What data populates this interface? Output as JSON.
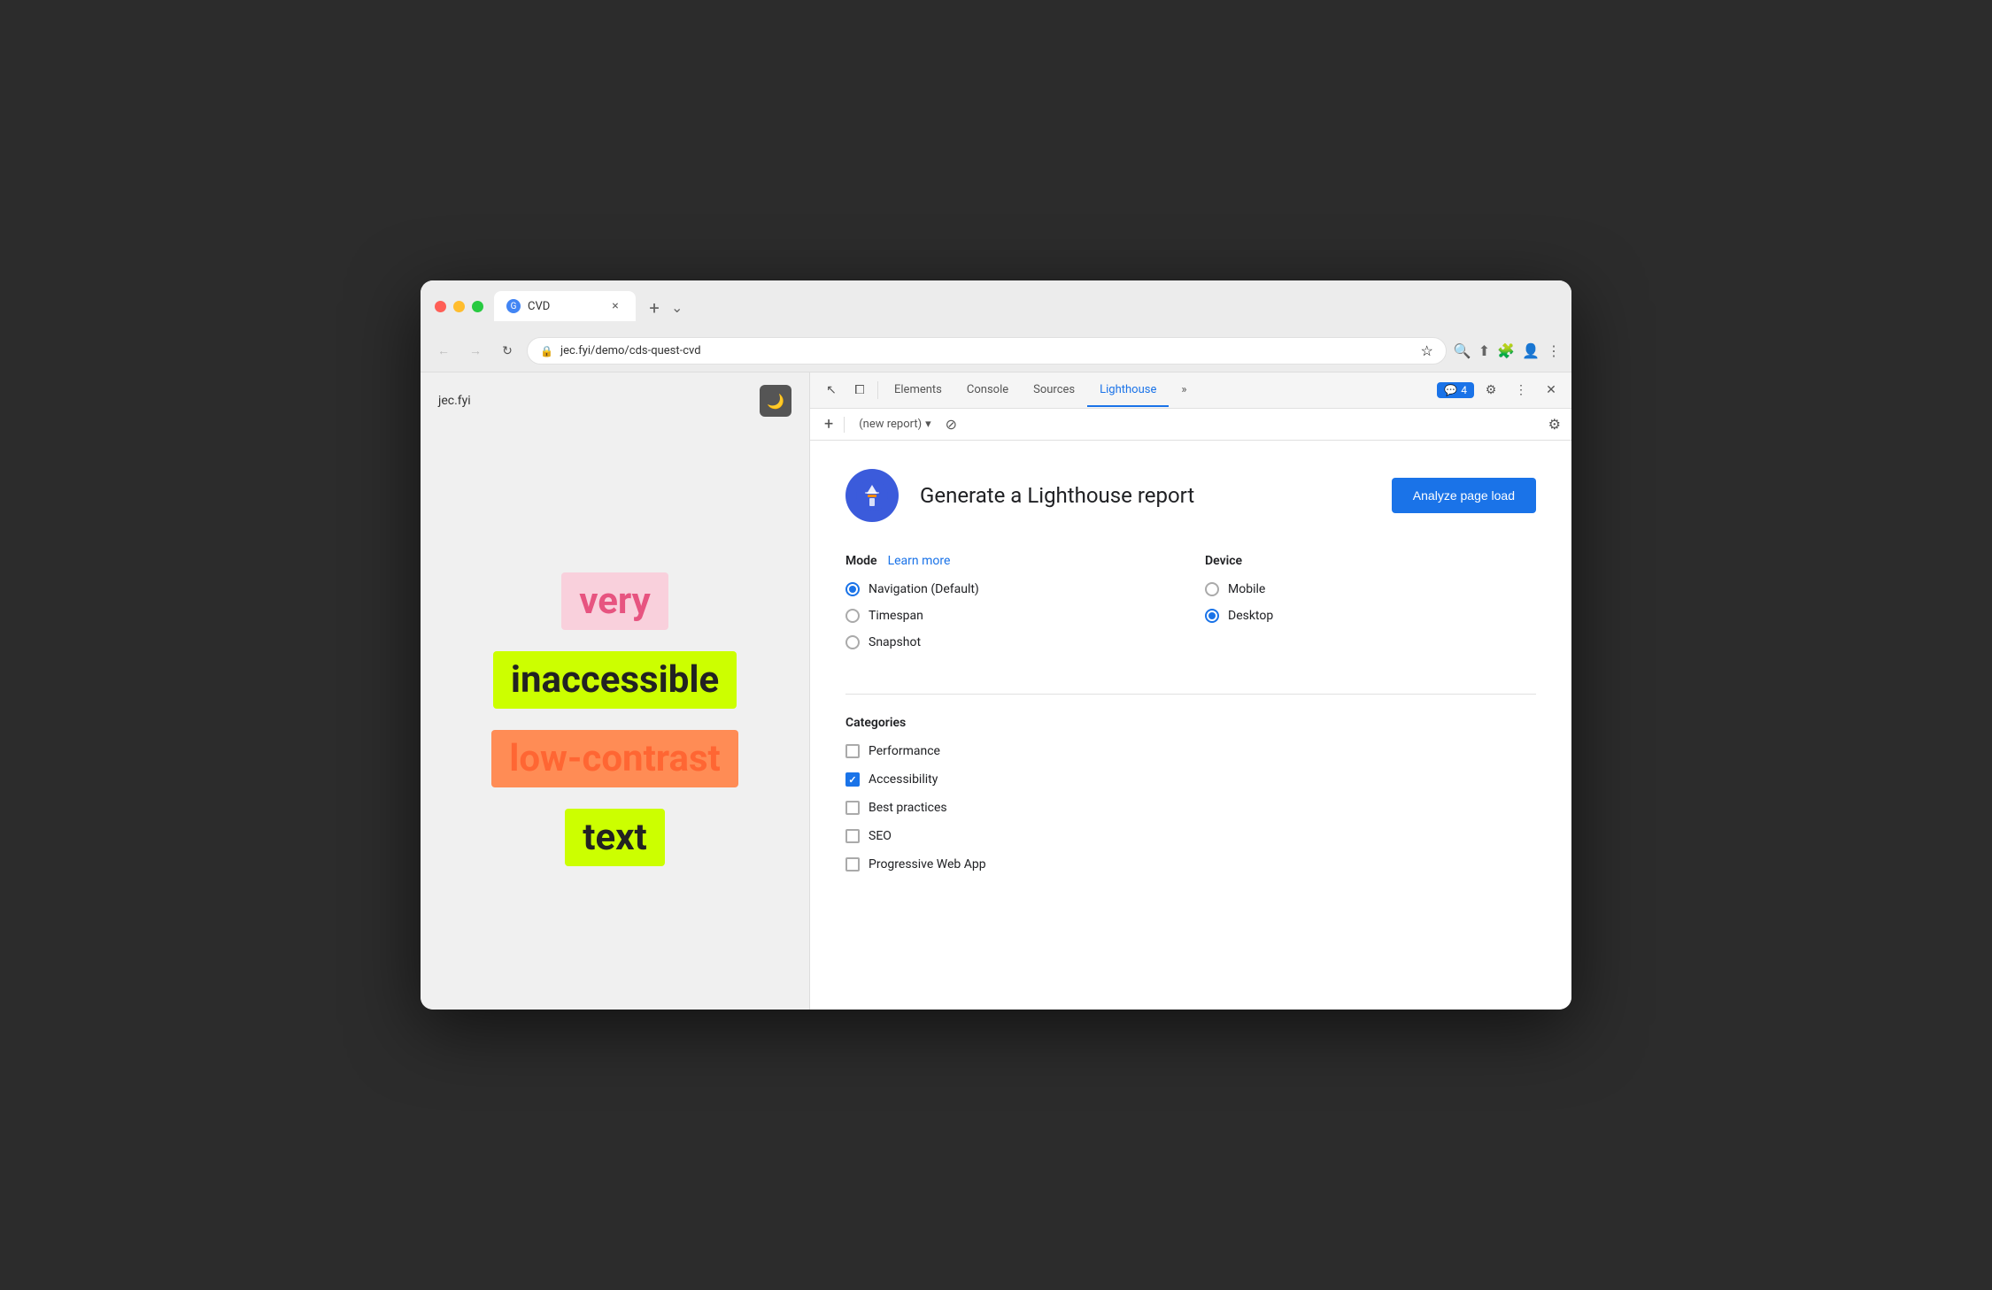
{
  "browser": {
    "tab": {
      "favicon_text": "G",
      "title": "CVD",
      "close_label": "×",
      "new_tab_label": "+"
    },
    "nav": {
      "back_label": "←",
      "forward_label": "→",
      "reload_label": "↻",
      "url": "jec.fyi/demo/cds-quest-cvd",
      "lock_icon": "🔒"
    },
    "address_icons": [
      "🔍",
      "⬆",
      "★",
      "🧩",
      "👤",
      "⋮",
      "⌄"
    ]
  },
  "devtools": {
    "icon_cursor": "↖",
    "icon_device": "⧠",
    "tabs": [
      {
        "label": "Elements",
        "active": false
      },
      {
        "label": "Console",
        "active": false
      },
      {
        "label": "Sources",
        "active": false
      },
      {
        "label": "Lighthouse",
        "active": true
      }
    ],
    "more_tabs_label": "»",
    "badge": {
      "icon": "💬",
      "count": "4"
    },
    "controls": {
      "gear_label": "⚙",
      "more_label": "⋮",
      "close_label": "✕"
    },
    "toolbar": {
      "add_label": "+",
      "report_placeholder": "(new report)",
      "dropdown_icon": "▾",
      "block_icon": "⊘",
      "gear_icon": "⚙"
    }
  },
  "webpage": {
    "title": "jec.fyi",
    "dark_mode_icon": "🌙",
    "words": [
      {
        "text": "very",
        "class": "word-very"
      },
      {
        "text": "inaccessible",
        "class": "word-inaccessible"
      },
      {
        "text": "low-contrast",
        "class": "word-low-contrast"
      },
      {
        "text": "text",
        "class": "word-text"
      }
    ]
  },
  "lighthouse": {
    "logo_alt": "Lighthouse logo",
    "title": "Generate a Lighthouse report",
    "analyze_button": "Analyze page load",
    "mode": {
      "label": "Mode",
      "learn_more": "Learn more",
      "options": [
        {
          "label": "Navigation (Default)",
          "checked": true
        },
        {
          "label": "Timespan",
          "checked": false
        },
        {
          "label": "Snapshot",
          "checked": false
        }
      ]
    },
    "device": {
      "label": "Device",
      "options": [
        {
          "label": "Mobile",
          "checked": false
        },
        {
          "label": "Desktop",
          "checked": true
        }
      ]
    },
    "categories": {
      "label": "Categories",
      "items": [
        {
          "label": "Performance",
          "checked": false
        },
        {
          "label": "Accessibility",
          "checked": true
        },
        {
          "label": "Best practices",
          "checked": false
        },
        {
          "label": "SEO",
          "checked": false
        },
        {
          "label": "Progressive Web App",
          "checked": false
        }
      ]
    }
  }
}
